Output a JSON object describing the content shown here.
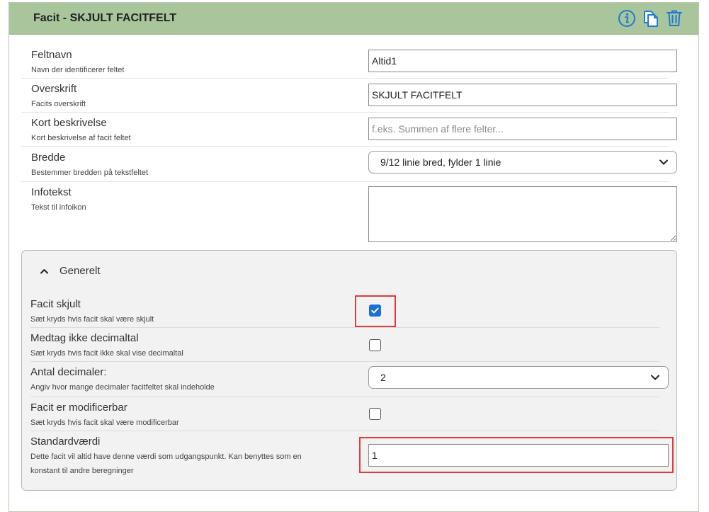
{
  "header": {
    "title": "Facit - SKJULT FACITFELT",
    "icons": [
      "info-icon",
      "copy-icon",
      "trash-icon"
    ],
    "accent_color": "#a9c59b",
    "icon_color": "#1f7bd1"
  },
  "fields": {
    "feltnavn": {
      "label": "Feltnavn",
      "help": "Navn der identificerer feltet",
      "value": "Altid1"
    },
    "overskrift": {
      "label": "Overskrift",
      "help": "Facits overskrift",
      "value": "SKJULT FACITFELT"
    },
    "kort": {
      "label": "Kort beskrivelse",
      "help": "Kort beskrivelse af facit feltet",
      "placeholder": "f.eks. Summen af flere felter..."
    },
    "bredde": {
      "label": "Bredde",
      "help": "Bestemmer bredden på tekstfeltet",
      "selected": "9/12 linie bred, fylder 1 linie"
    },
    "infotekst": {
      "label": "Infotekst",
      "help": "Tekst til infoikon",
      "value": ""
    }
  },
  "group": {
    "title": "Generelt",
    "skjult": {
      "label": "Facit skjult",
      "help": "Sæt kryds hvis facit skal være skjult",
      "checked": true
    },
    "decimal": {
      "label": "Medtag ikke decimaltal",
      "help": "Sæt kryds hvis facit ikke skal vise decimaltal",
      "checked": false
    },
    "antal": {
      "label": "Antal decimaler:",
      "help": "Angiv hvor mange decimaler facitfeltet skal indeholde",
      "selected": "2"
    },
    "modificerbar": {
      "label": "Facit er modificerbar",
      "help": "Sæt kryds hvis facit skal være modificerbar",
      "checked": false
    },
    "standard": {
      "label": "Standardværdi",
      "help_line1": "Dette facit vil altid have denne værdi som udgangspunkt. Kan benyttes som en",
      "help_line2": "konstant til andre beregninger",
      "value": "1"
    }
  }
}
